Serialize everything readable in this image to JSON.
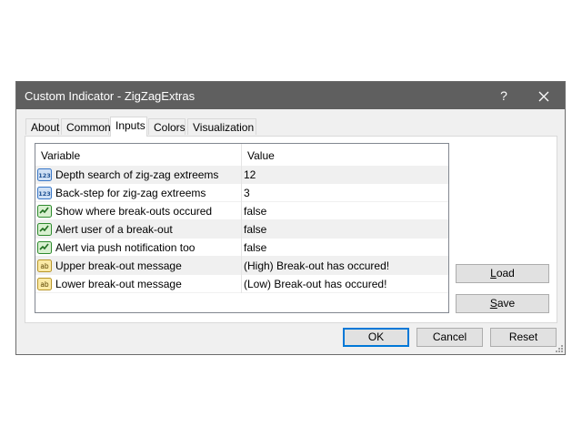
{
  "window": {
    "title": "Custom Indicator - ZigZagExtras",
    "help_glyph": "?",
    "close_glyph": "✕"
  },
  "tabs": [
    {
      "label": "About",
      "active": false
    },
    {
      "label": "Common",
      "active": false
    },
    {
      "label": "Inputs",
      "active": true
    },
    {
      "label": "Colors",
      "active": false
    },
    {
      "label": "Visualization",
      "active": false
    }
  ],
  "table": {
    "headers": {
      "variable": "Variable",
      "value": "Value"
    },
    "rows": [
      {
        "icon": "integer-icon",
        "variable": "Depth search of zig-zag extreems",
        "value": "12"
      },
      {
        "icon": "integer-icon",
        "variable": "Back-step for zig-zag extreems",
        "value": "3"
      },
      {
        "icon": "boolean-icon",
        "variable": "Show where break-outs occured",
        "value": "false"
      },
      {
        "icon": "boolean-icon",
        "variable": "Alert user of a break-out",
        "value": "false"
      },
      {
        "icon": "boolean-icon",
        "variable": "Alert via push notification too",
        "value": "false"
      },
      {
        "icon": "string-icon",
        "variable": "Upper break-out message",
        "value": "(High) Break-out has occured!"
      },
      {
        "icon": "string-icon",
        "variable": "Lower break-out message",
        "value": "(Low) Break-out has occured!"
      }
    ]
  },
  "side_buttons": {
    "load": {
      "mnemonic": "L",
      "rest": "oad"
    },
    "save": {
      "mnemonic": "S",
      "rest": "ave"
    }
  },
  "footer": {
    "ok_label": "OK",
    "cancel_label": "Cancel",
    "reset_label": "Reset"
  },
  "icon_text": {
    "integer": "123",
    "string": "ab"
  },
  "colors": {
    "titlebar": "#5f5f5f",
    "default_button_border": "#0078d7",
    "integer_icon": "#3a78c8",
    "boolean_icon": "#2e8b2e",
    "string_icon": "#e6c84a"
  }
}
